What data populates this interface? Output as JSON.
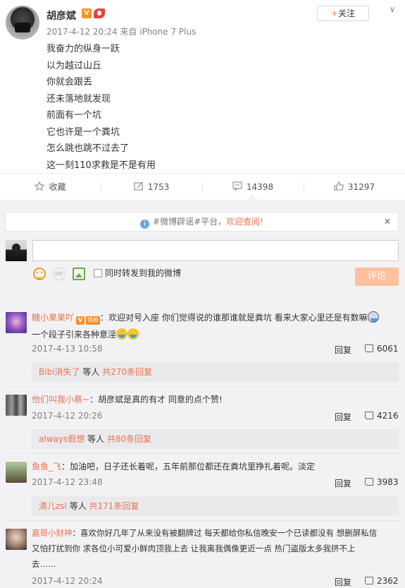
{
  "post": {
    "author": "胡彦斌",
    "v_badge": "V",
    "meta": "2017-4-12 20:24 来自 iPhone 7 Plus",
    "follow_label": "关注",
    "follow_plus": "+",
    "more_glyph": "∨",
    "lines": [
      "我奋力的纵身一跃",
      "以为越过山丘",
      "你就会跟丢",
      "还未落地就发现",
      "前面有一个坑",
      "它也许是一个粪坑",
      "怎么跳也跳不过去了",
      "这一刻110求救是不是有用"
    ]
  },
  "actions": {
    "collect": "收藏",
    "repost": "1753",
    "comment": "14398",
    "like": "31297"
  },
  "notice": {
    "prefix": "#微博辟谣#平台，",
    "link": "欢迎查阅!",
    "close": "✕"
  },
  "composer": {
    "checkbox_label": "同时转发到我的微博",
    "submit_label": "评论",
    "gif_label": "GIF"
  },
  "comments": [
    {
      "user": "糖小果果吖",
      "badge_v": "V",
      "badge_fan": "铁粉",
      "text_a": "：欢迎对号入座  你们觉得说的谁那谁就是粪坑  看来大家心里还是有数嘛",
      "text_b": "一个段子引来各种意淫",
      "time": "2017-4-13 10:58",
      "reply": "回复",
      "likes": "6061",
      "sub_user": "Bibi消失了",
      "sub_mid": " 等人 ",
      "sub_count": "共270条回复"
    },
    {
      "user": "他们叫我小蔡~",
      "text_a": "：胡彦斌是真的有才 同意的点个赞!",
      "time": "2017-4-12 20:26",
      "reply": "回复",
      "likes": "4216",
      "sub_user": "always假想",
      "sub_mid": " 等人 ",
      "sub_count": "共80条回复"
    },
    {
      "user": "鱼鱼_飞",
      "text_a": "：加油吧，日子还长着呢，五年前那位都还在粪坑里挣扎着呢。淡定",
      "time": "2017-4-12 23:48",
      "reply": "回复",
      "likes": "3983",
      "sub_user": "清儿zsl",
      "sub_mid": " 等人 ",
      "sub_count": "共171条回复"
    },
    {
      "user": "嘉哥小财神",
      "text_a": "：喜欢你好几年了从来没有被翻牌过  每天都给你私信晚安一个已读都没有  想删屏私信",
      "text_b": "又怕打扰到你  求各位小可爱小鲜肉顶我上去 让我离我偶像更近一点  热门盗版太多我挤不上",
      "text_c": "去……",
      "time": "2017-4-12 20:24",
      "reply": "回复",
      "likes": "2362"
    }
  ]
}
